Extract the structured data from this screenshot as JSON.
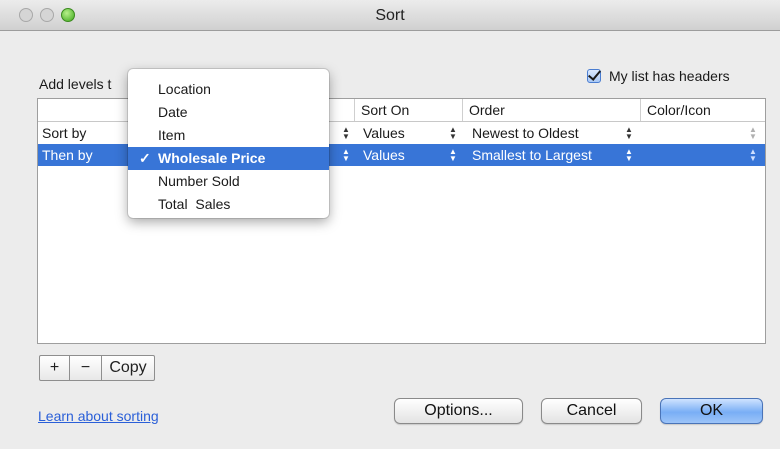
{
  "window": {
    "title": "Sort"
  },
  "toolbar": {
    "add_levels_label": "Add levels t",
    "headers_checkbox": {
      "label": "My list has headers",
      "checked": true
    }
  },
  "table": {
    "columns": [
      "Sort On",
      "Order",
      "Color/Icon"
    ],
    "rows": [
      {
        "label": "Sort by",
        "sort_on": "Values",
        "order": "Newest to Oldest",
        "selected": false
      },
      {
        "label": "Then by",
        "sort_on": "Values",
        "order": "Smallest to Largest",
        "selected": true
      }
    ]
  },
  "dropdown": {
    "options": [
      "Location",
      "Date",
      "Item",
      "Wholesale Price",
      "Number Sold",
      "Total  Sales"
    ],
    "selected_index": 3,
    "check_mark": "✓"
  },
  "level_buttons": {
    "add": "+",
    "remove": "−",
    "copy": "Copy"
  },
  "footer": {
    "learn_link": "Learn about sorting",
    "options_button": "Options...",
    "cancel_button": "Cancel",
    "ok_button": "OK"
  },
  "icons": {
    "updown": "updown-arrows-icon",
    "checkmark": "checkmark-icon"
  },
  "colors": {
    "selection": "#3875d7",
    "link": "#2a5fd8",
    "default_button": "#79aef5"
  }
}
